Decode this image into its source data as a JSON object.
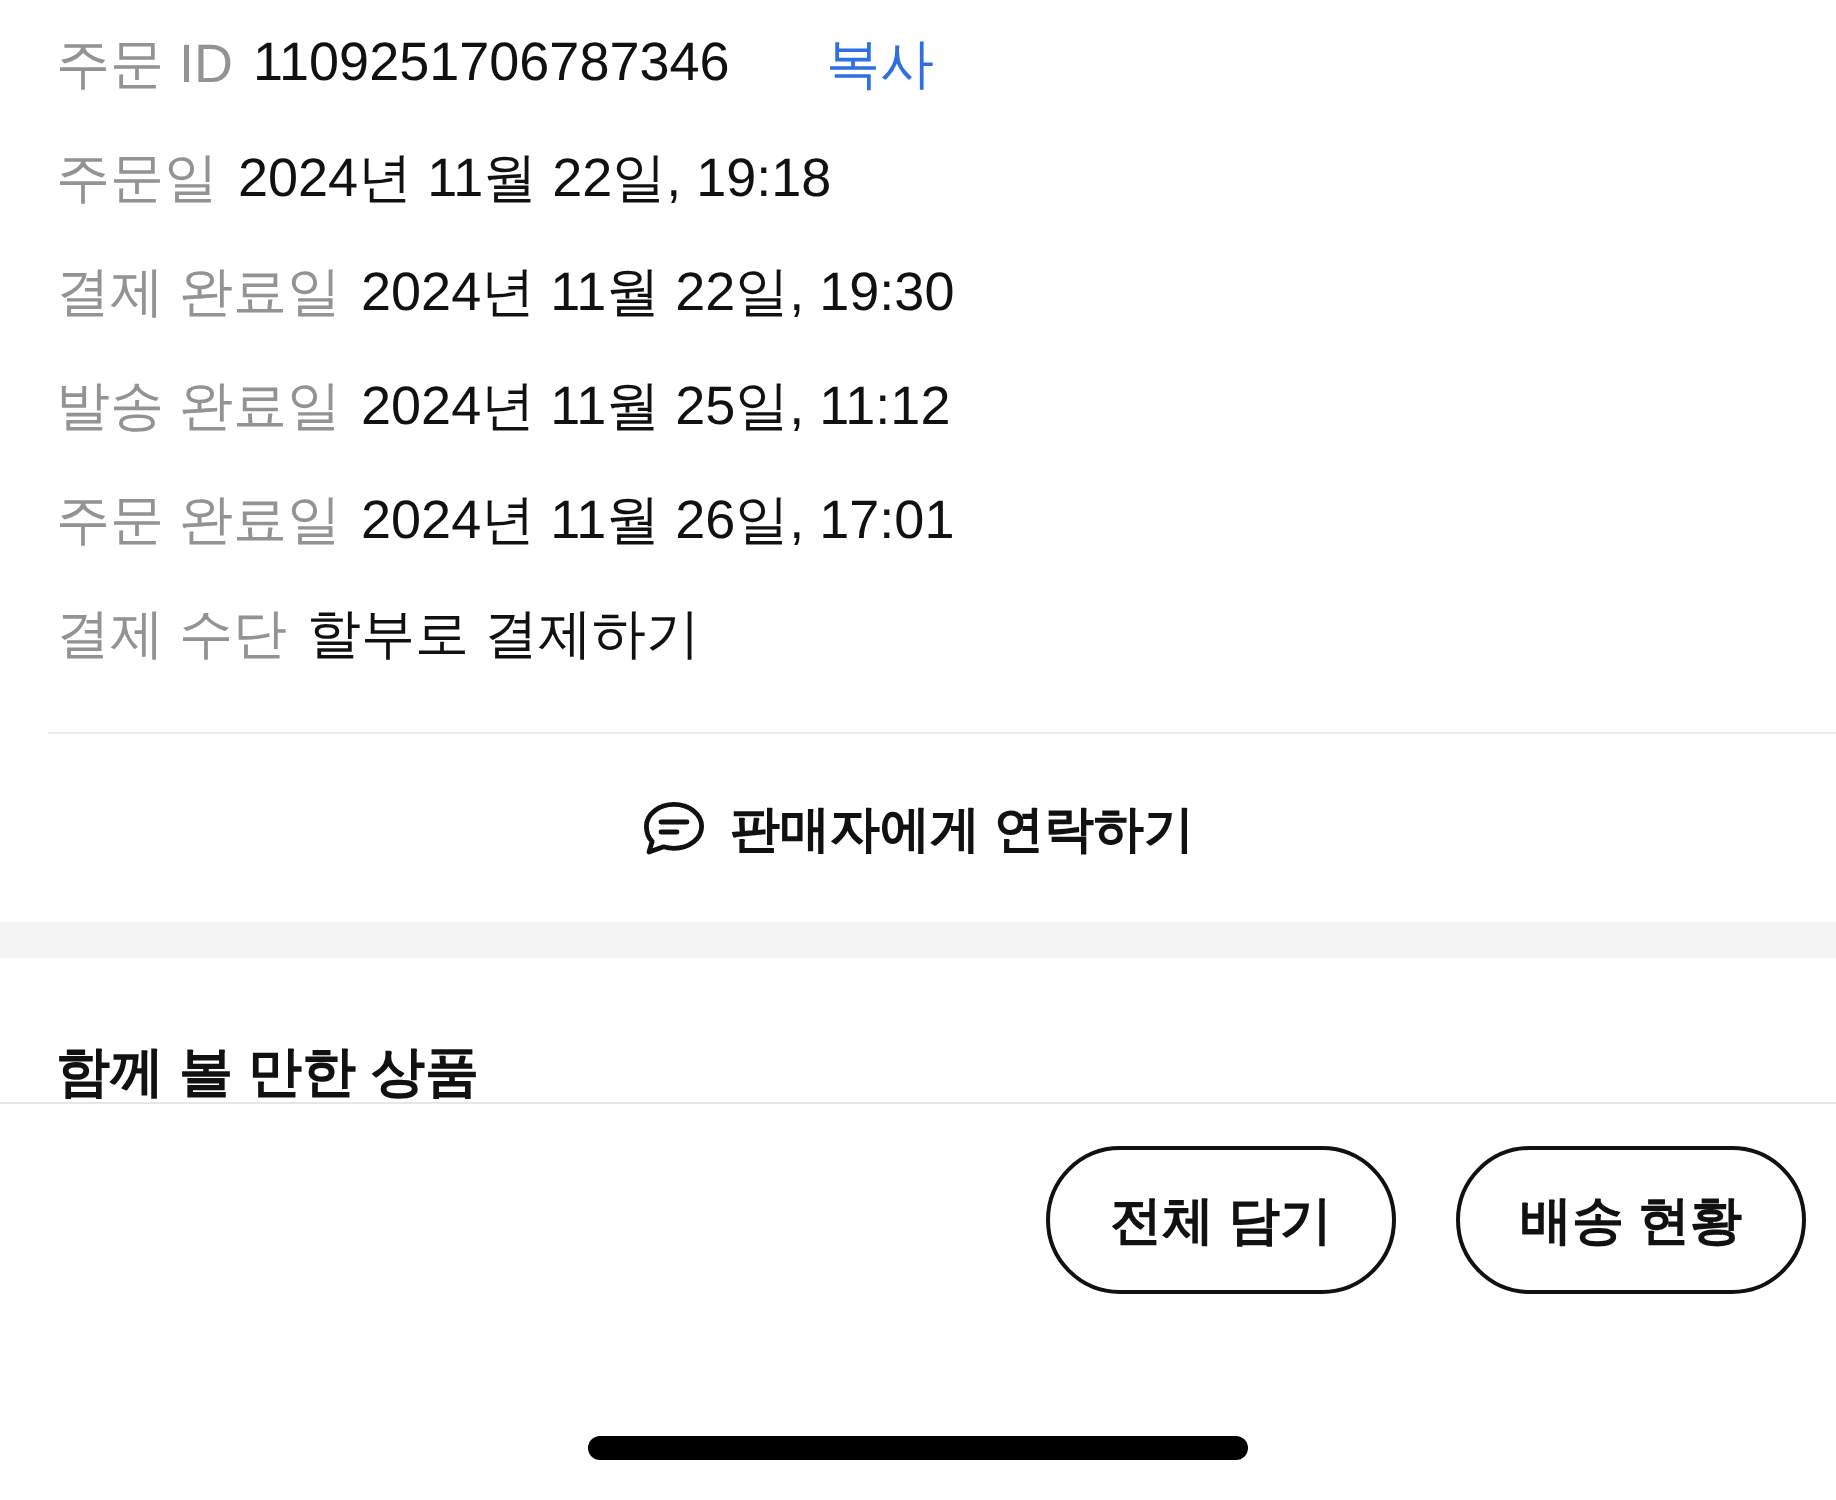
{
  "order_info": [
    {
      "label": "주문 ID",
      "value": "1109251706787346",
      "action": "복사"
    },
    {
      "label": "주문일",
      "value": "2024년 11월 22일, 19:18"
    },
    {
      "label": "결제 완료일",
      "value": "2024년 11월 22일, 19:30"
    },
    {
      "label": "발송 완료일",
      "value": "2024년 11월 25일, 11:12"
    },
    {
      "label": "주문 완료일",
      "value": "2024년 11월 26일, 17:01"
    },
    {
      "label": "결제 수단",
      "value": "할부로 결제하기"
    }
  ],
  "contact_button": {
    "label": "판매자에게 연락하기"
  },
  "recommendations": {
    "title": "함께 볼 만한 상품"
  },
  "bottom_bar": {
    "buttons": [
      {
        "label": "전체 담기"
      },
      {
        "label": "배송 현황"
      }
    ]
  }
}
